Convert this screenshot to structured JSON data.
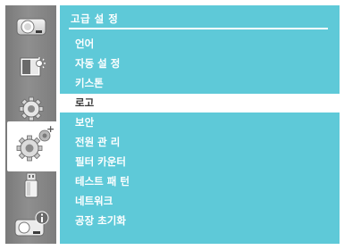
{
  "panel": {
    "title": "고급 설 정",
    "items": [
      {
        "label": "언어"
      },
      {
        "label": "자동 설 정"
      },
      {
        "label": "키스톤"
      },
      {
        "label": "로고",
        "selected": true
      },
      {
        "label": "보안"
      },
      {
        "label": "전원 관 리"
      },
      {
        "label": "필터 카운터"
      },
      {
        "label": "테스트 패 턴"
      },
      {
        "label": "네트워크"
      },
      {
        "label": "공장 초기화"
      }
    ]
  },
  "sidebar": {
    "icons": [
      {
        "name": "display-settings-icon"
      },
      {
        "name": "image-adjust-icon"
      },
      {
        "name": "settings-gear-icon"
      },
      {
        "name": "advanced-settings-icon",
        "selected": true
      },
      {
        "name": "usb-icon"
      },
      {
        "name": "info-icon"
      }
    ]
  },
  "colors": {
    "panel_bg": "#5ec9d8",
    "sidebar_bg": "#8a8a8a",
    "highlight_bg": "#ffffff",
    "highlight_text": "#3a3a3a"
  }
}
